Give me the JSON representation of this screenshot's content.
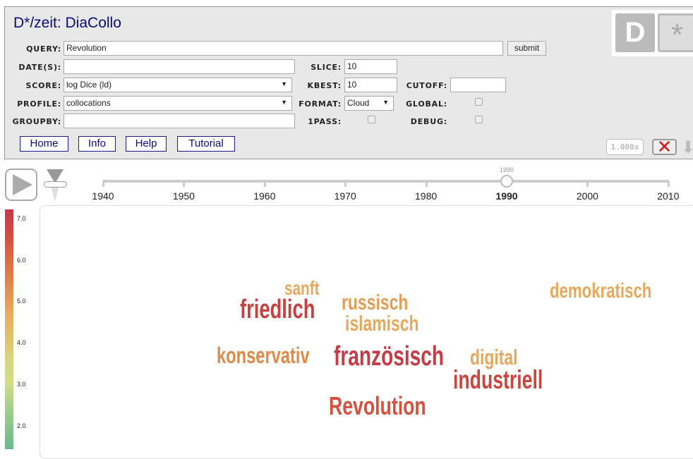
{
  "header": {
    "title": "D*/zeit: DiaCollo",
    "logo_text": "D*"
  },
  "form": {
    "query_label": "QUERY:",
    "query_value": "Revolution",
    "submit_label": "submit",
    "dates_label": "DATE(S):",
    "dates_value": "",
    "score_label": "SCORE:",
    "score_value": "log Dice (ld)",
    "profile_label": "PROFILE:",
    "profile_value": "collocations",
    "groupby_label": "GROUPBY:",
    "groupby_value": "",
    "slice_label": "SLICE:",
    "slice_value": "10",
    "kbest_label": "KBEST:",
    "kbest_value": "10",
    "format_label": "FORMAT:",
    "format_value": "Cloud",
    "onepass_label": "1PASS:",
    "cutoff_label": "CUTOFF:",
    "cutoff_value": "",
    "global_label": "GLOBAL:",
    "debug_label": "DEBUG:"
  },
  "nav": [
    "Home",
    "Info",
    "Help",
    "Tutorial"
  ],
  "toolbar": {
    "zoom": "1.000x"
  },
  "timeline": {
    "years": [
      "1940",
      "1950",
      "1960",
      "1970",
      "1980",
      "1990",
      "2000",
      "2010"
    ],
    "selected": "1990",
    "selected_label": "1990"
  },
  "colorscale": {
    "labels": [
      "7.0",
      "6.0",
      "5.0",
      "4.0",
      "3.0",
      "2.0"
    ]
  },
  "cloud": [
    {
      "word": "sanft",
      "color": "#e6a85c"
    },
    {
      "word": "friedlich",
      "color": "#c8403f"
    },
    {
      "word": "russisch",
      "color": "#e29e55"
    },
    {
      "word": "islamisch",
      "color": "#e6a85c"
    },
    {
      "word": "demokratisch",
      "color": "#e6a85c"
    },
    {
      "word": "konservativ",
      "color": "#e08a4a"
    },
    {
      "word": "französisch",
      "color": "#c43c48"
    },
    {
      "word": "digital",
      "color": "#e6a85c"
    },
    {
      "word": "industriell",
      "color": "#cc4640"
    },
    {
      "word": "Revolution",
      "color": "#d5503f"
    }
  ]
}
